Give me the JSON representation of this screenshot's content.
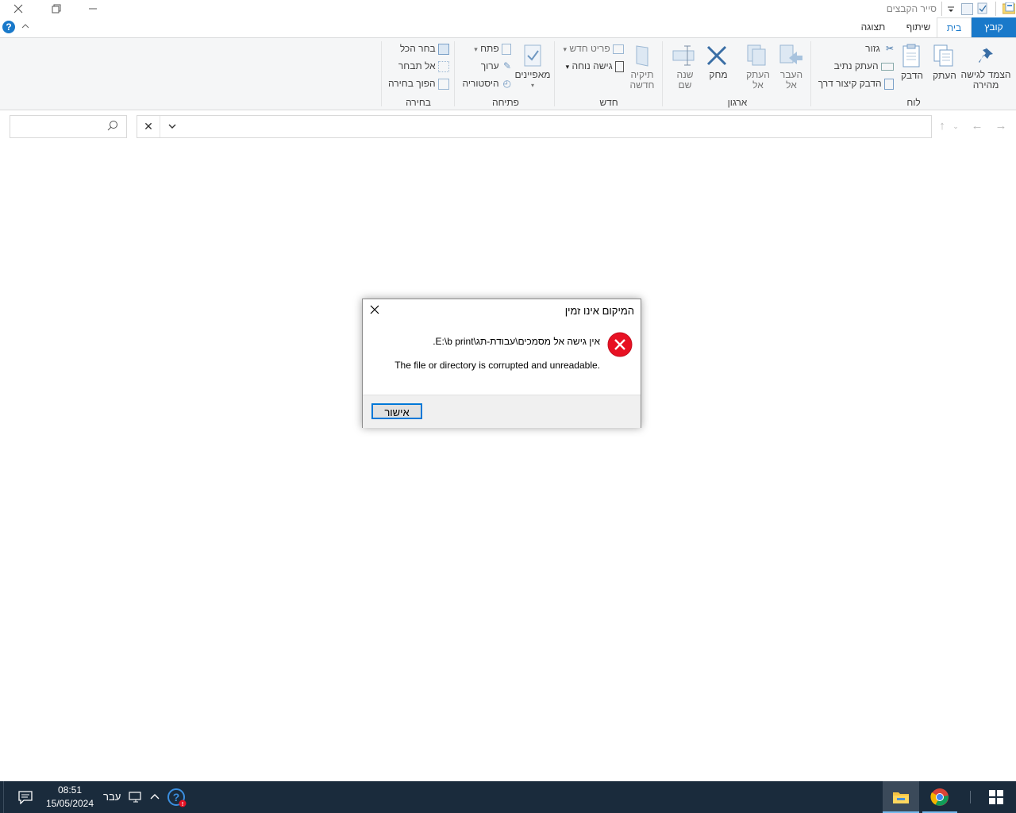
{
  "window": {
    "title": "סייר הקבצים",
    "tabs": [
      "קובץ",
      "בית",
      "שיתוף",
      "תצוגה"
    ]
  },
  "ribbon": {
    "clipboard": {
      "label": "לוח",
      "pin": "הצמד לגישה מהירה",
      "copy": "העתק",
      "paste": "הדבק",
      "cut": "גזור",
      "copy_path": "העתק נתיב",
      "paste_shortcut": "הדבק קיצור דרך"
    },
    "organize": {
      "label": "ארגון",
      "move_to": "העבר אל",
      "copy_to": "העתק אל",
      "delete": "מחק",
      "rename": "שנה שם"
    },
    "new": {
      "label": "חדש",
      "new_folder": "תיקיה חדשה",
      "new_item": "פריט חדש",
      "easy_access": "גישה נוחה"
    },
    "open": {
      "label": "פתיחה",
      "properties": "מאפיינים",
      "open": "פתח",
      "edit": "ערוך",
      "history": "היסטוריה"
    },
    "select": {
      "label": "בחירה",
      "select_all": "בחר הכל",
      "select_none": "אל תבחר",
      "invert": "הפוך בחירה"
    }
  },
  "address": {
    "path": "",
    "search_placeholder": ""
  },
  "dialog": {
    "title": "המיקום אינו זמין",
    "message": "אין גישה אל מסמכים\\עבודת-תג\\E:\\b print.",
    "detail": "The file or directory is corrupted and unreadable.",
    "ok": "אישור"
  },
  "taskbar": {
    "time": "08:51",
    "date": "15/05/2024",
    "language": "עבר"
  },
  "colors": {
    "accent": "#1979ca",
    "error": "#e81123",
    "taskbar": "#1a2b3c"
  }
}
